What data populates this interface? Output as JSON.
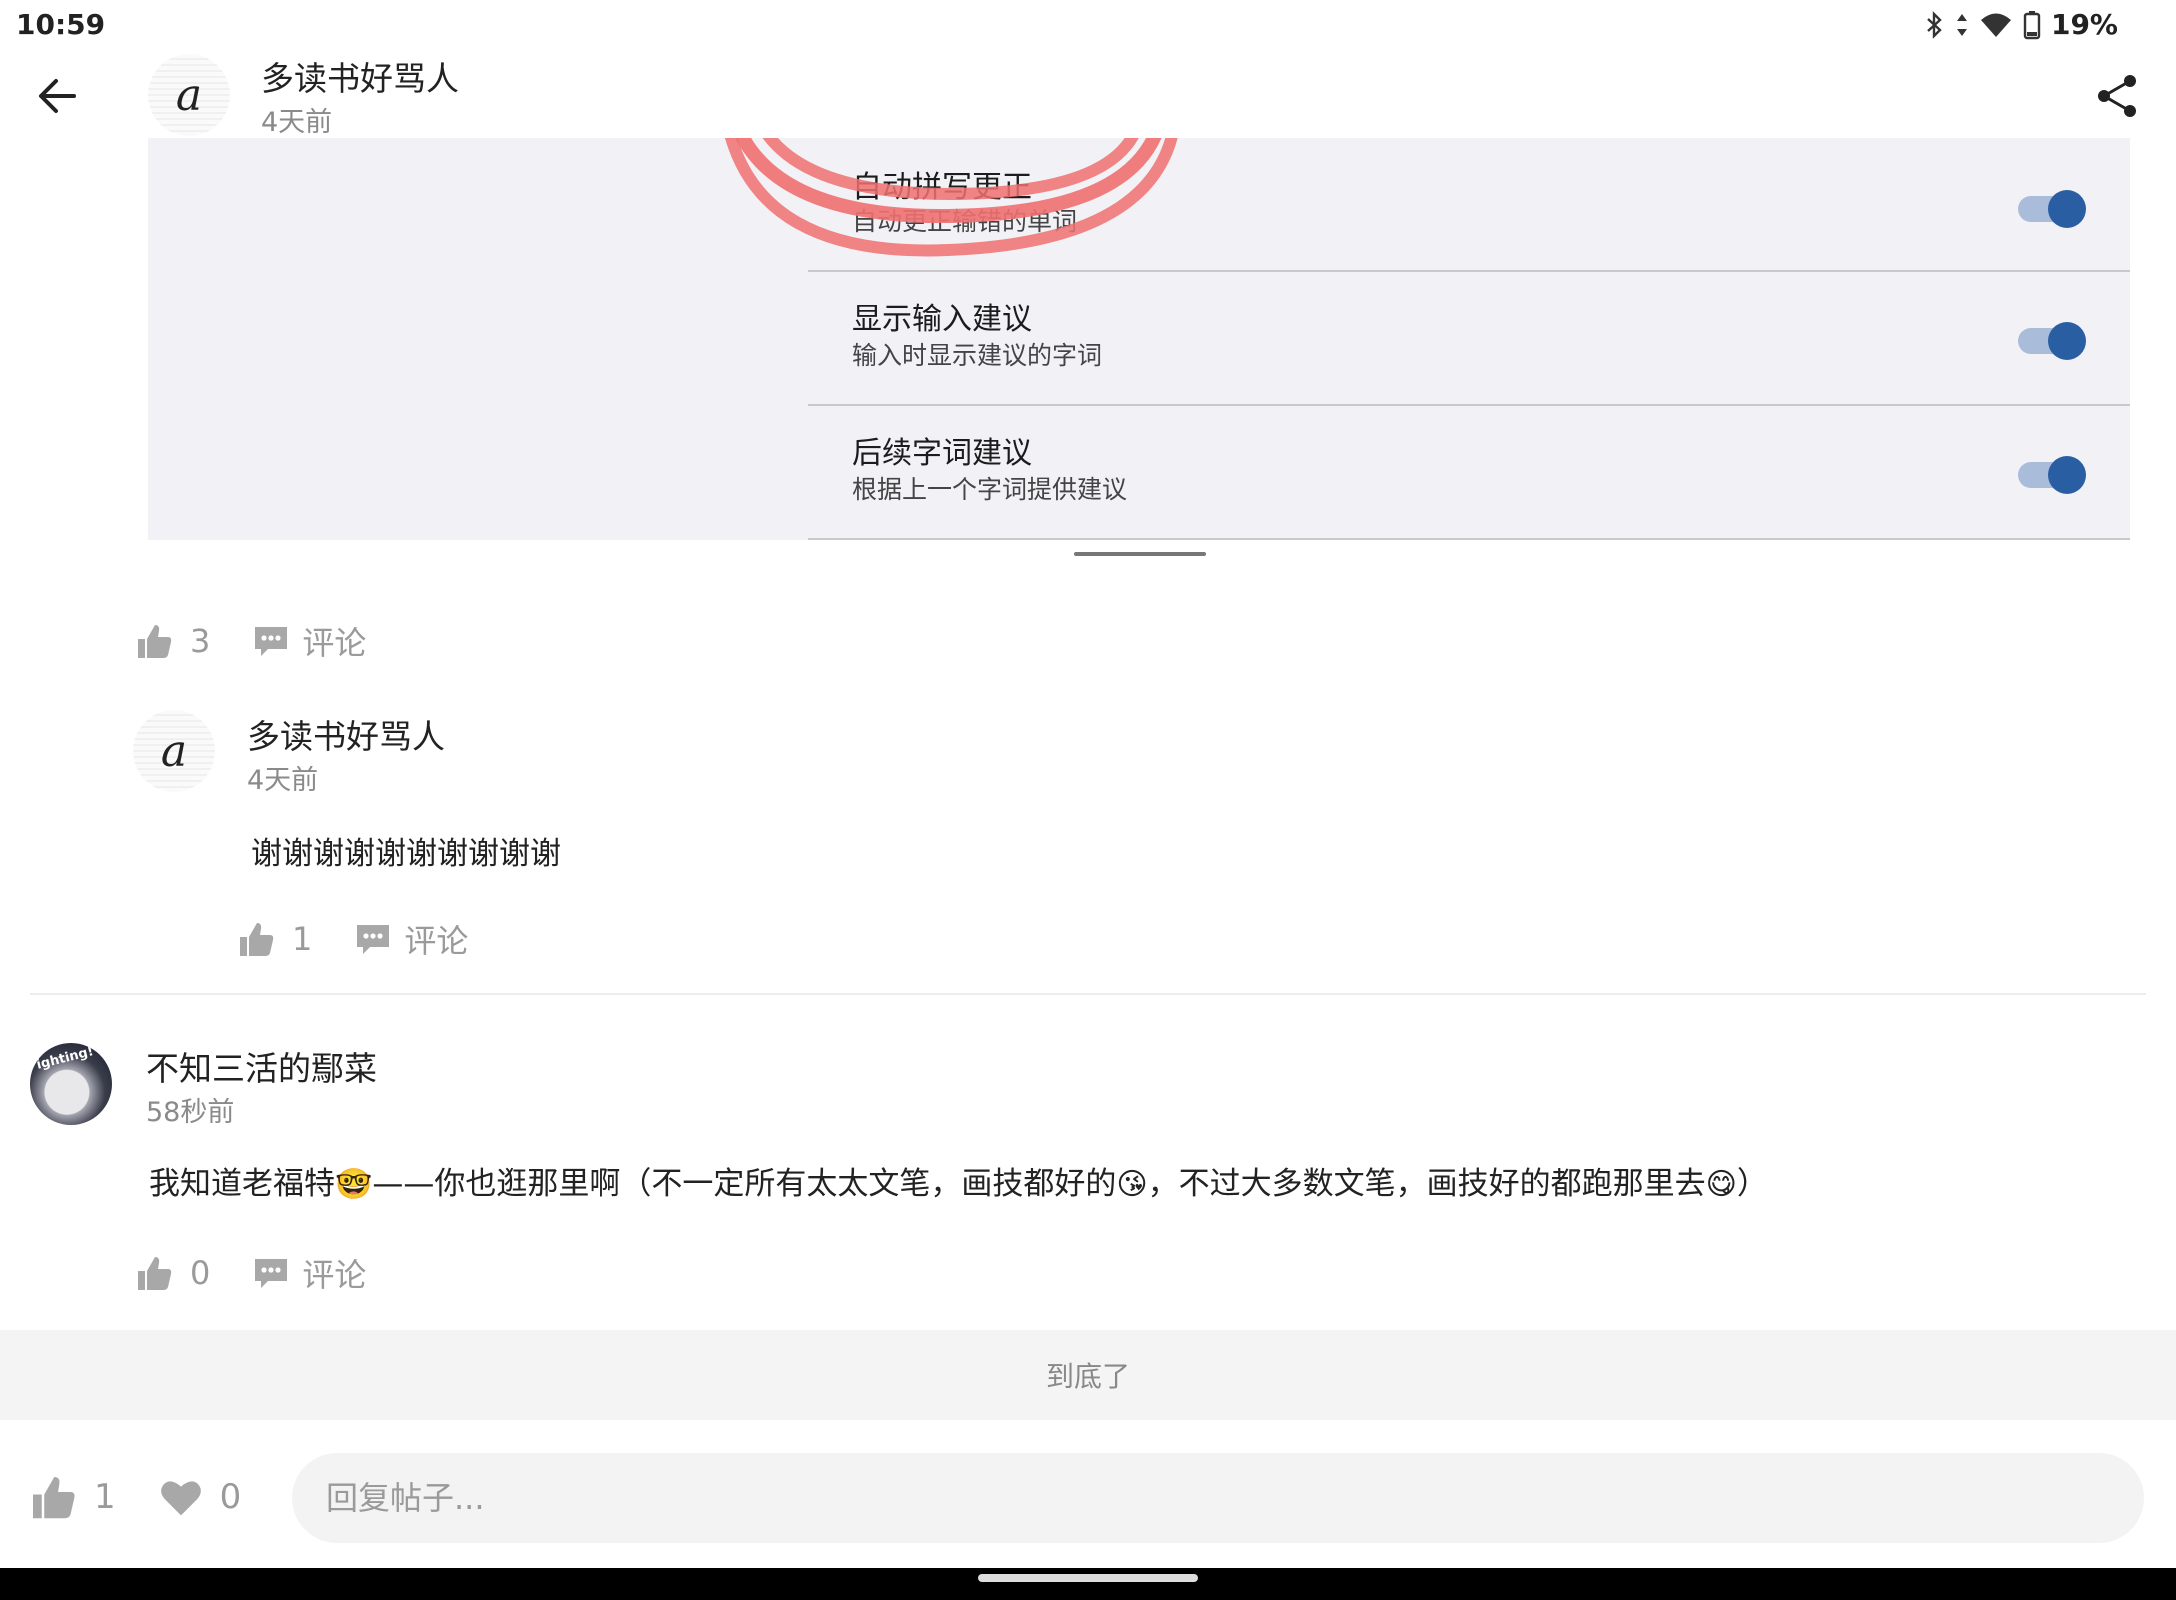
{
  "status_bar": {
    "time": "10:59",
    "battery": "19%"
  },
  "post": {
    "author": "多读书好骂人",
    "time": "4天前",
    "settings_image": {
      "rows": [
        {
          "title": "自动拼写更正",
          "subtitle": "自动更正输错的单词"
        },
        {
          "title": "显示输入建议",
          "subtitle": "输入时显示建议的字词"
        },
        {
          "title": "后续字词建议",
          "subtitle": "根据上一个字词提供建议"
        }
      ]
    },
    "likes": "3",
    "comment_label": "评论"
  },
  "reply": {
    "author": "多读书好骂人",
    "time": "4天前",
    "text": "谢谢谢谢谢谢谢谢谢谢",
    "likes": "1",
    "comment_label": "评论"
  },
  "comment": {
    "author": "不知三活的鄢菜",
    "time": "58秒前",
    "avatar_text": "ighting!",
    "text_parts": [
      "我知道老福特",
      "——你也逛那里啊（不一定所有太太文笔，画技都好的",
      "，不过大多数文笔，画技好的都跑那里去",
      "）"
    ],
    "emojis": [
      "🤓",
      "😘",
      "😋"
    ],
    "likes": "0",
    "comment_label": "评论"
  },
  "end_text": "到底了",
  "bottom_bar": {
    "likes": "1",
    "favorites": "0",
    "reply_placeholder": "回复帖子..."
  },
  "icons": [
    "back-arrow-icon",
    "share-icon",
    "thumb-up-icon",
    "comment-bubble-icon",
    "heart-icon",
    "bluetooth-icon",
    "wifi-icon",
    "battery-icon"
  ],
  "colors": {
    "toggle_on": "#2a5ea3",
    "toggle_track": "#a9bcd9",
    "annotation_red": "#f07070"
  }
}
